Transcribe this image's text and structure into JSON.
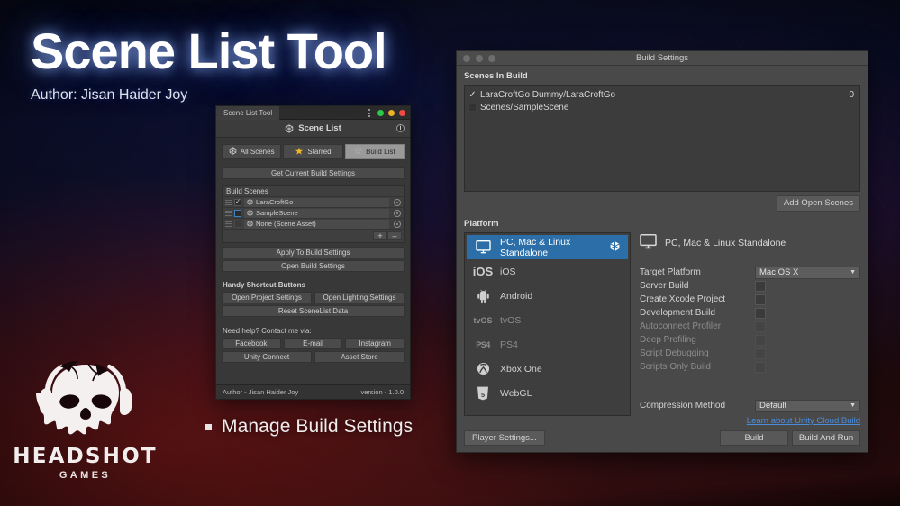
{
  "hero": {
    "title": "Scene List Tool",
    "author": "Author: Jisan Haider Joy",
    "bullet": "Manage Build Settings"
  },
  "logo": {
    "word": "HEADSHOT",
    "sub": "GAMES",
    "icon": "skull-headphones-icon"
  },
  "scene_list_tool": {
    "window_tab": "Scene List Tool",
    "header_title": "Scene List",
    "header_icon": "unity-scene-icon",
    "help_badge": "i",
    "window_dots": [
      "green",
      "yellow",
      "red"
    ],
    "tabs": [
      {
        "label": "All Scenes",
        "icon": "unity-icon",
        "active": false
      },
      {
        "label": "Starred",
        "icon": "star-icon",
        "active": false
      },
      {
        "label": "Build List",
        "icon": "star-outline-icon",
        "active": true
      }
    ],
    "get_settings_button": "Get Current Build Settings",
    "build_scenes_header": "Build Scenes",
    "build_scenes": [
      {
        "name": "LaraCroftGo",
        "checked": true,
        "focused": false
      },
      {
        "name": "SampleScene",
        "checked": false,
        "focused": true
      },
      {
        "name": "None (Scene Asset)",
        "checked": false,
        "focused": false,
        "no_checkbox": true
      }
    ],
    "add_button": "+",
    "remove_button": "–",
    "apply_button": "Apply To Build Settings",
    "open_build_button": "Open Build Settings",
    "shortcut_label": "Handy Shortcut Buttons",
    "shortcut_buttons": [
      "Open Project Settings",
      "Open Lighting Settings",
      "Reset SceneList Data"
    ],
    "contact_label": "Need help? Contact me via:",
    "contact_buttons": [
      "Facebook",
      "E-mail",
      "Instagram",
      "Unity Connect",
      "Asset Store"
    ],
    "footer_author": "Author - Jisan Haider Joy",
    "footer_version": "version - 1.0.0"
  },
  "build_settings": {
    "window_title": "Build Settings",
    "scenes_in_build_label": "Scenes In Build",
    "scenes": [
      {
        "path": "LaraCroftGo Dummy/LaraCroftGo",
        "checked": true,
        "index": "0"
      },
      {
        "path": "Scenes/SampleScene",
        "checked": false,
        "index": ""
      }
    ],
    "add_open_scenes_button": "Add Open Scenes",
    "platform_label": "Platform",
    "platforms": [
      {
        "label": "PC, Mac & Linux Standalone",
        "icon": "monitor-icon",
        "selected": true,
        "dim": false
      },
      {
        "label": "iOS",
        "icon": "ios-icon",
        "selected": false,
        "dim": false
      },
      {
        "label": "Android",
        "icon": "android-icon",
        "selected": false,
        "dim": false
      },
      {
        "label": "tvOS",
        "icon": "tvos-icon",
        "selected": false,
        "dim": true
      },
      {
        "label": "PS4",
        "icon": "ps4-icon",
        "selected": false,
        "dim": true
      },
      {
        "label": "Xbox One",
        "icon": "xbox-icon",
        "selected": false,
        "dim": false
      },
      {
        "label": "WebGL",
        "icon": "webgl-icon",
        "selected": false,
        "dim": false
      }
    ],
    "detail_title": "PC, Mac & Linux Standalone",
    "detail_icon": "monitor-icon",
    "target_platform_label": "Target Platform",
    "target_platform_value": "Mac OS X",
    "options": [
      {
        "label": "Server Build",
        "dim": false,
        "checked": false
      },
      {
        "label": "Create Xcode Project",
        "dim": false,
        "checked": false
      },
      {
        "label": "Development Build",
        "dim": false,
        "checked": false
      },
      {
        "label": "Autoconnect Profiler",
        "dim": true,
        "checked": false
      },
      {
        "label": "Deep Profiling",
        "dim": true,
        "checked": false
      },
      {
        "label": "Script Debugging",
        "dim": true,
        "checked": false
      },
      {
        "label": "Scripts Only Build",
        "dim": true,
        "checked": false
      }
    ],
    "compression_label": "Compression Method",
    "compression_value": "Default",
    "cloud_link": "Learn about Unity Cloud Build",
    "player_settings_button": "Player Settings...",
    "build_button": "Build",
    "build_and_run_button": "Build And Run"
  },
  "colors": {
    "accent_blue": "#2b6ea8",
    "link_blue": "#4c8ddb",
    "star_yellow": "#f0b429",
    "dot_green": "#2dc94a",
    "dot_yellow": "#ebb028",
    "dot_red": "#ef4b42"
  }
}
